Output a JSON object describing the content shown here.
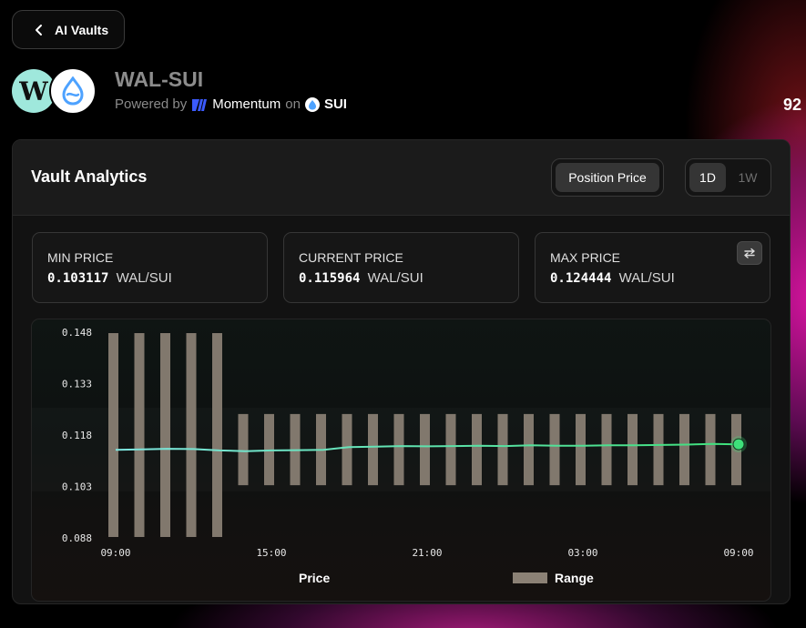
{
  "nav": {
    "back_label": "AI Vaults"
  },
  "pair": {
    "title": "WAL-SUI",
    "token_a_letter": "W",
    "powered_prefix": "Powered by",
    "protocol": "Momentum",
    "on_text": "on",
    "chain": "SUI"
  },
  "top_right_number": "92",
  "analytics": {
    "title": "Vault Analytics",
    "mode_label": "Position Price",
    "ranges": [
      "1D",
      "1W"
    ],
    "active_range": "1D"
  },
  "prices": {
    "min": {
      "label": "MIN PRICE",
      "value": "0.103117",
      "unit": "WAL/SUI"
    },
    "current": {
      "label": "CURRENT PRICE",
      "value": "0.115964",
      "unit": "WAL/SUI"
    },
    "max": {
      "label": "MAX PRICE",
      "value": "0.124444",
      "unit": "WAL/SUI"
    }
  },
  "colors": {
    "accent_green": "#3ee07a",
    "line_cyan": "#7fe6e0",
    "range_bar": "#8b8175",
    "token_a_bg": "#9fe8dc",
    "sui_blue": "#4da2ff"
  },
  "chart_data": {
    "type": "bar",
    "yticks": [
      "0.148",
      "0.133",
      "0.118",
      "0.103",
      "0.088"
    ],
    "ylim": [
      0.088,
      0.148
    ],
    "xticks": [
      {
        "label": "09:00",
        "index": 0
      },
      {
        "label": "15:00",
        "index": 6
      },
      {
        "label": "21:00",
        "index": 12
      },
      {
        "label": "03:00",
        "index": 18
      },
      {
        "label": "09:00",
        "index": 24
      }
    ],
    "range_bars": [
      [
        0.088,
        0.148
      ],
      [
        0.088,
        0.148
      ],
      [
        0.088,
        0.148
      ],
      [
        0.088,
        0.148
      ],
      [
        0.088,
        0.148
      ],
      [
        0.1031,
        0.1244
      ],
      [
        0.1031,
        0.1244
      ],
      [
        0.1031,
        0.1244
      ],
      [
        0.1031,
        0.1244
      ],
      [
        0.1031,
        0.1244
      ],
      [
        0.1031,
        0.1244
      ],
      [
        0.1031,
        0.1244
      ],
      [
        0.1031,
        0.1244
      ],
      [
        0.1031,
        0.1244
      ],
      [
        0.1031,
        0.1244
      ],
      [
        0.1031,
        0.1244
      ],
      [
        0.1031,
        0.1244
      ],
      [
        0.1031,
        0.1244
      ],
      [
        0.1031,
        0.1244
      ],
      [
        0.1031,
        0.1244
      ],
      [
        0.1031,
        0.1244
      ],
      [
        0.1031,
        0.1244
      ],
      [
        0.1031,
        0.1244
      ],
      [
        0.1031,
        0.1244
      ],
      [
        0.1031,
        0.1244
      ]
    ],
    "price_line": [
      0.1137,
      0.1138,
      0.114,
      0.1139,
      0.1135,
      0.1133,
      0.1135,
      0.1136,
      0.1137,
      0.1145,
      0.1146,
      0.1148,
      0.1147,
      0.1148,
      0.1149,
      0.1148,
      0.115,
      0.1149,
      0.1149,
      0.115,
      0.115,
      0.1151,
      0.1152,
      0.1154,
      0.1153
    ],
    "series": [
      {
        "name": "Price"
      },
      {
        "name": "Range"
      }
    ],
    "legend": "bottom"
  }
}
